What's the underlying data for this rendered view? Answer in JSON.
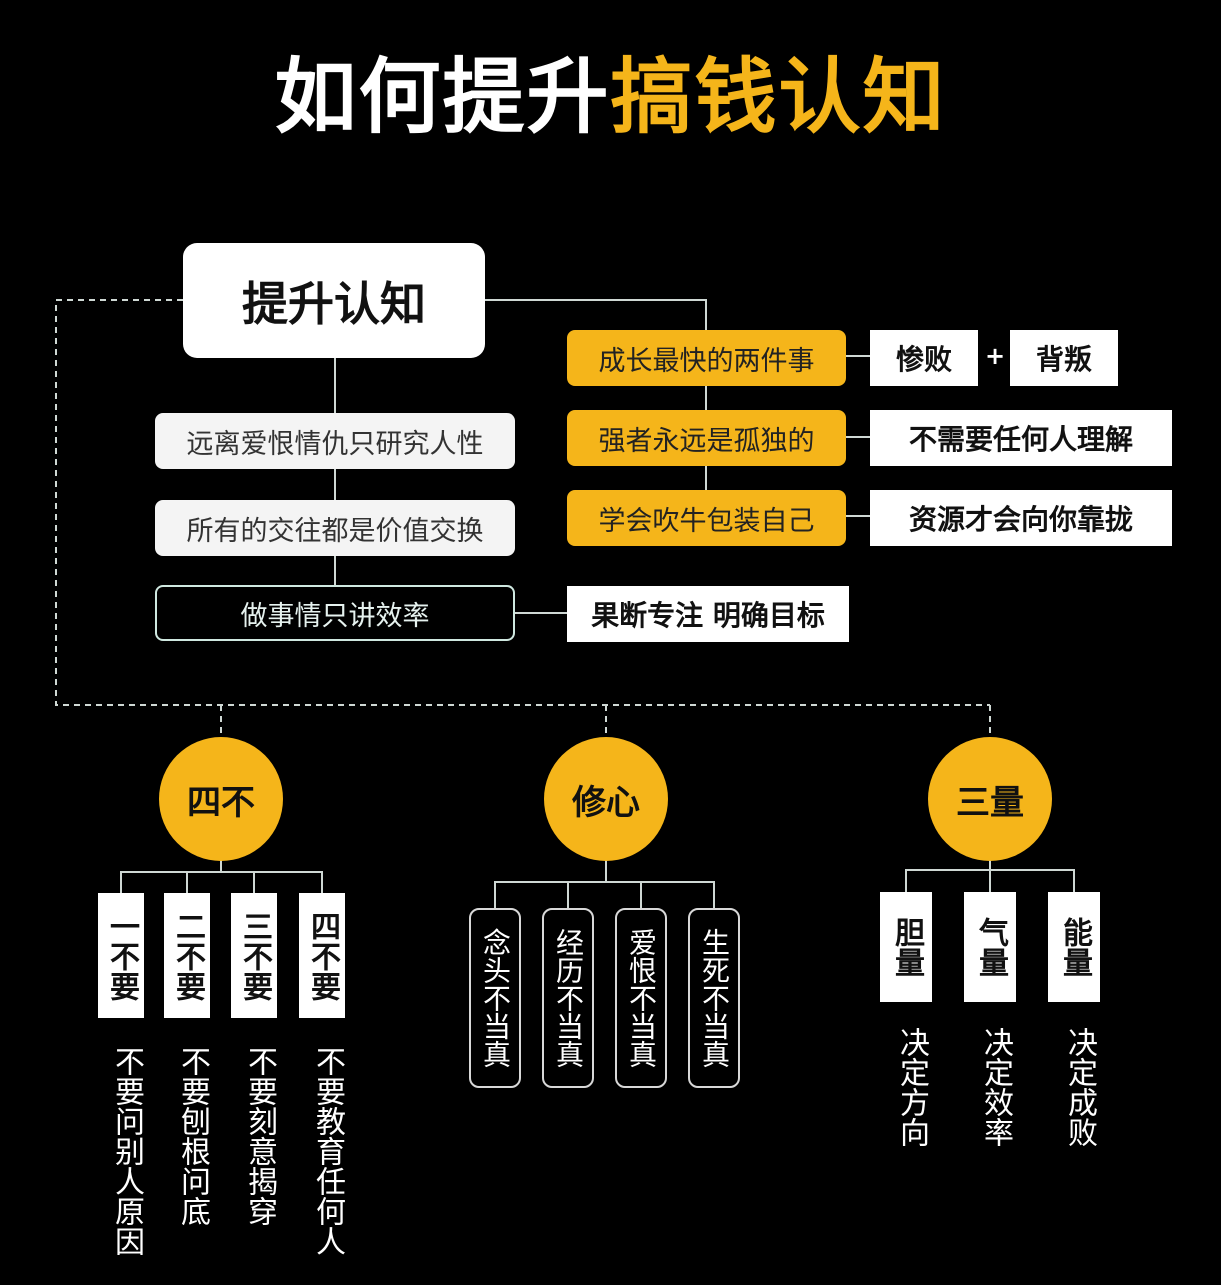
{
  "title": {
    "part1": "如何提升",
    "part2": "搞钱认知"
  },
  "root": {
    "label": "提升认知"
  },
  "left_items": [
    {
      "label": "远离爱恨情仇只研究人性"
    },
    {
      "label": "所有的交往都是价值交换"
    },
    {
      "label": "做事情只讲效率",
      "result": "果断专注 明确目标"
    }
  ],
  "right_items": [
    {
      "label": "成长最快的两件事",
      "results": [
        "惨败",
        "背叛"
      ],
      "connector": "+"
    },
    {
      "label": "强者永远是孤独的",
      "results": [
        "不需要任何人理解"
      ]
    },
    {
      "label": "学会吹牛包装自己",
      "results": [
        "资源才会向你靠拢"
      ]
    }
  ],
  "groups": {
    "sibu": {
      "label": "四不",
      "items": [
        {
          "tag": "一不要",
          "text": "不要问别人原因"
        },
        {
          "tag": "二不要",
          "text": "不要刨根问底"
        },
        {
          "tag": "三不要",
          "text": "不要刻意揭穿"
        },
        {
          "tag": "四不要",
          "text": "不要教育任何人"
        }
      ]
    },
    "xiuxin": {
      "label": "修心",
      "items": [
        "念头不当真",
        "经历不当真",
        "爱恨不当真",
        "生死不当真"
      ]
    },
    "sanliang": {
      "label": "三量",
      "items": [
        {
          "tag": "胆量",
          "text": "决定方向"
        },
        {
          "tag": "气量",
          "text": "决定效率"
        },
        {
          "tag": "能量",
          "text": "决定成败"
        }
      ]
    }
  },
  "colors": {
    "accent": "#f5b51a",
    "background": "#000000",
    "box": "#ffffff"
  }
}
